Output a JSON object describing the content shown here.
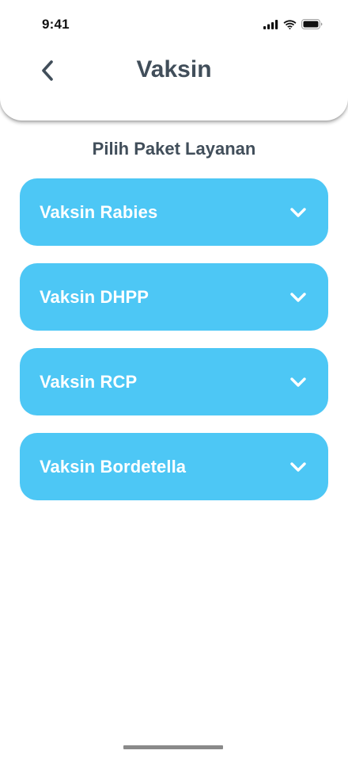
{
  "status_bar": {
    "time": "9:41",
    "icons": [
      "cellular-signal-icon",
      "wifi-icon",
      "battery-icon"
    ]
  },
  "header": {
    "back_icon": "chevron-left-icon",
    "title": "Vaksin"
  },
  "section": {
    "heading": "Pilih Paket Layanan"
  },
  "packages": [
    {
      "label": "Vaksin Rabies",
      "icon": "chevron-down-icon"
    },
    {
      "label": "Vaksin DHPP",
      "icon": "chevron-down-icon"
    },
    {
      "label": "Vaksin RCP",
      "icon": "chevron-down-icon"
    },
    {
      "label": "Vaksin Bordetella",
      "icon": "chevron-down-icon"
    }
  ],
  "colors": {
    "accent": "#4dc7f5",
    "title_text": "#414e5a",
    "card_text": "#ffffff",
    "background": "#ffffff"
  }
}
